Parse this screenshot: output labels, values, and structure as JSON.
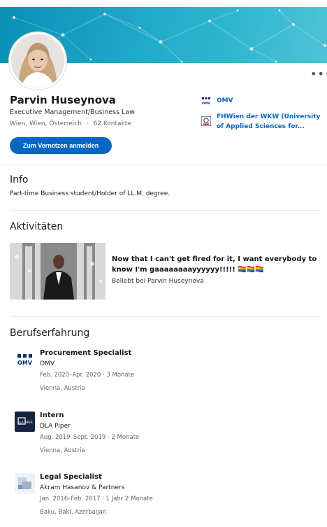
{
  "profile": {
    "name": "Parvin Huseynova",
    "headline": "Executive Management/Business Law",
    "location": "Wien, Wien, Österreich",
    "separator": "·",
    "contacts": "62 Kontakte",
    "connect_label": "Zum Vernetzen anmelden",
    "more_label": "•••"
  },
  "side": {
    "items": [
      {
        "label": "OMV",
        "icon": "omv-logo-icon"
      },
      {
        "label": "FHWien der WKW (University of Applied Sciences for...",
        "icon": "fhwien-logo-icon"
      }
    ]
  },
  "info": {
    "title": "Info",
    "text": "Part-time Business student/Holder of LL.M. degree."
  },
  "activity": {
    "title": "Aktivitäten",
    "post_text": "Now that I can't get fired for it, I want everybody to know I'm gaaaaaaaayyyyyy!!!!! 🏳️‍🌈🏳️‍🌈🏳️‍🌈",
    "post_sub": "Beliebt bei Parvin Huseynova"
  },
  "experience": {
    "title": "Berufserfahrung",
    "items": [
      {
        "title": "Procurement Specialist",
        "company": "OMV",
        "dates": "Feb. 2020–Apr. 2020 · 3 Monate",
        "location": "Vienna, Austria",
        "icon": "omv-logo-icon"
      },
      {
        "title": "Intern",
        "company": "DLA Piper",
        "dates": "Aug. 2019–Sept. 2019 · 2 Monate",
        "location": "Vienna, Austria",
        "icon": "dla-piper-logo-icon"
      },
      {
        "title": "Legal Specialist",
        "company": "Akram Hasanov & Partners",
        "dates": "Jan. 2016–Feb. 2017 · 1 Jahr 2 Monate",
        "location": "Baku, Baki, Azerbaijan",
        "icon": "company-placeholder-icon"
      }
    ]
  },
  "logos": {
    "omv_text": "OMV",
    "dla_text": "DLA PIPER"
  },
  "colors": {
    "accent": "#0a66c2",
    "banner": "#1fa7c9"
  }
}
